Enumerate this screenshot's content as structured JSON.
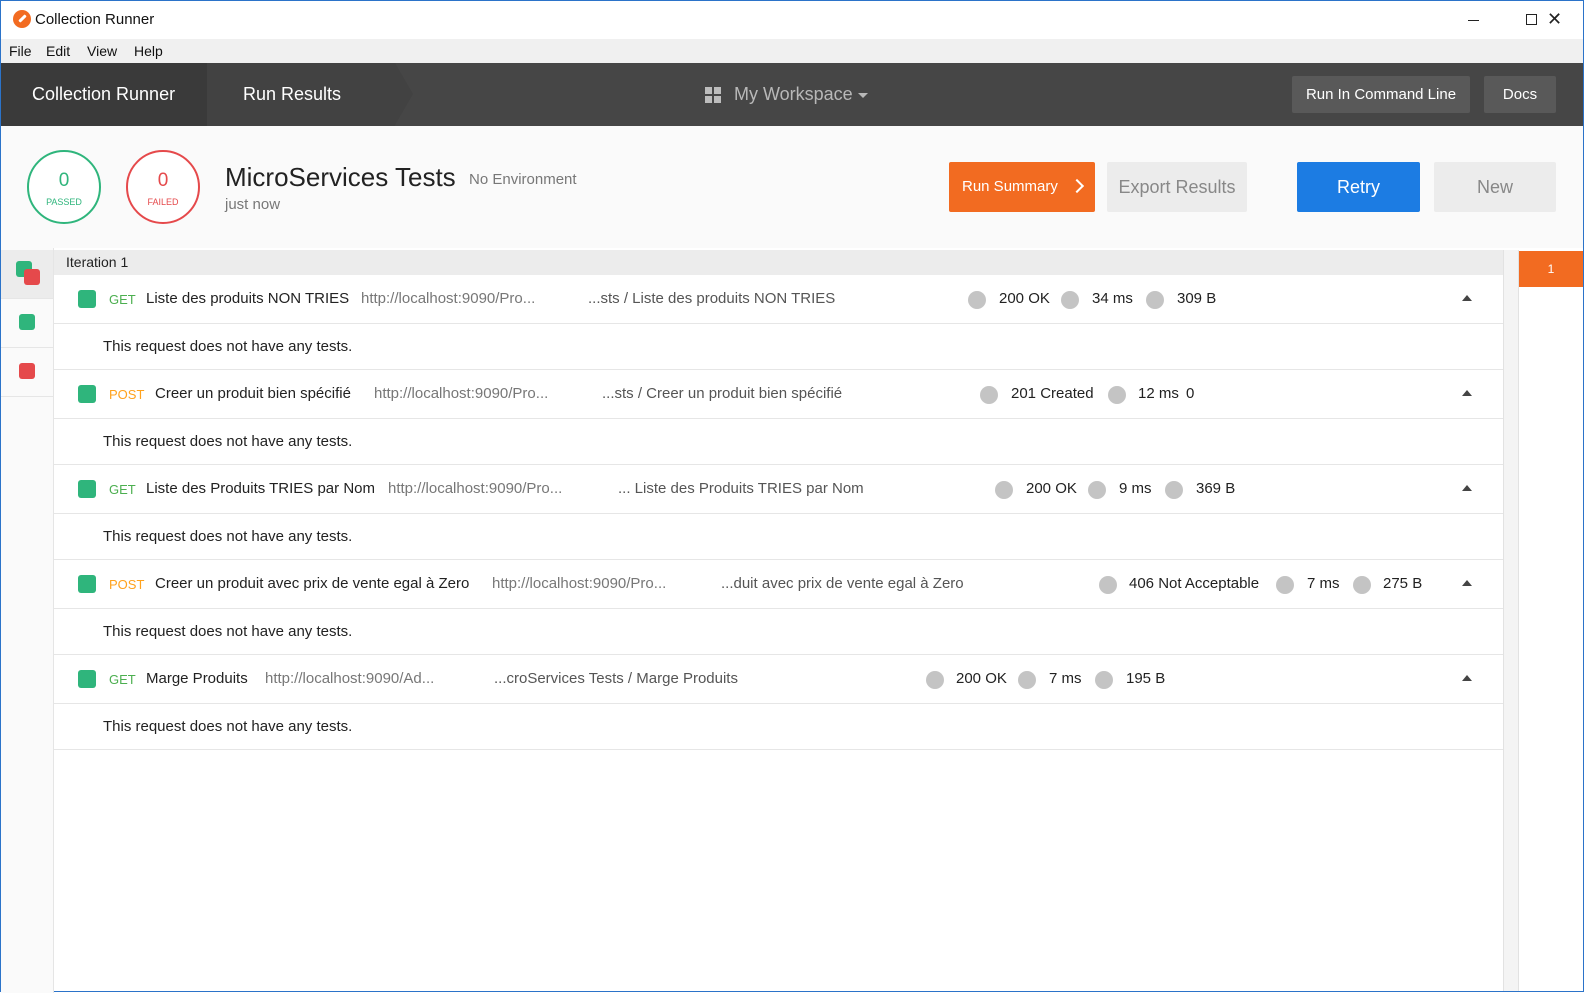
{
  "window": {
    "title": "Collection Runner"
  },
  "menu": [
    "File",
    "Edit",
    "View",
    "Help"
  ],
  "header": {
    "breadcrumb1": "Collection Runner",
    "breadcrumb2": "Run Results",
    "workspace": "My Workspace",
    "cli_button": "Run In Command Line",
    "docs_button": "Docs"
  },
  "summary": {
    "passed_count": "0",
    "passed_label": "PASSED",
    "failed_count": "0",
    "failed_label": "FAILED",
    "collection_name": "MicroServices Tests",
    "environment": "No Environment",
    "time": "just now",
    "run_summary": "Run Summary",
    "export": "Export Results",
    "retry": "Retry",
    "new": "New"
  },
  "iteration": {
    "label": "Iteration 1",
    "marker": "1"
  },
  "no_tests_msg": "This request does not have any tests.",
  "requests": [
    {
      "method": "GET",
      "name": "Liste des produits NON TRIES",
      "url": "http://localhost:9090/Pro...",
      "path": "...sts / Liste des produits NON TRIES",
      "status": "200 OK",
      "time": "34 ms",
      "size": "309 B"
    },
    {
      "method": "POST",
      "name": "Creer un produit bien spécifié",
      "url": "http://localhost:9090/Pro...",
      "path": "...sts / Creer un produit bien spécifié",
      "status": "201 Created",
      "time": "12 ms",
      "size": "0"
    },
    {
      "method": "GET",
      "name": "Liste des Produits TRIES par Nom",
      "url": "http://localhost:9090/Pro...",
      "path": "... Liste des Produits TRIES par Nom",
      "status": "200 OK",
      "time": "9 ms",
      "size": "369 B"
    },
    {
      "method": "POST",
      "name": "Creer un produit avec prix de vente egal à Zero",
      "url": "http://localhost:9090/Pro...",
      "path": "...duit avec prix de vente egal à Zero",
      "status": "406 Not Acceptable",
      "time": "7 ms",
      "size": "275 B"
    },
    {
      "method": "GET",
      "name": "Marge Produits",
      "url": "http://localhost:9090/Ad...",
      "path": "...croServices Tests / Marge Produits",
      "status": "200 OK",
      "time": "7 ms",
      "size": "195 B"
    }
  ],
  "colors": {
    "accent": "#f26b21",
    "primary": "#1c7ce3",
    "pass": "#2fb57c",
    "fail": "#e5494b"
  }
}
